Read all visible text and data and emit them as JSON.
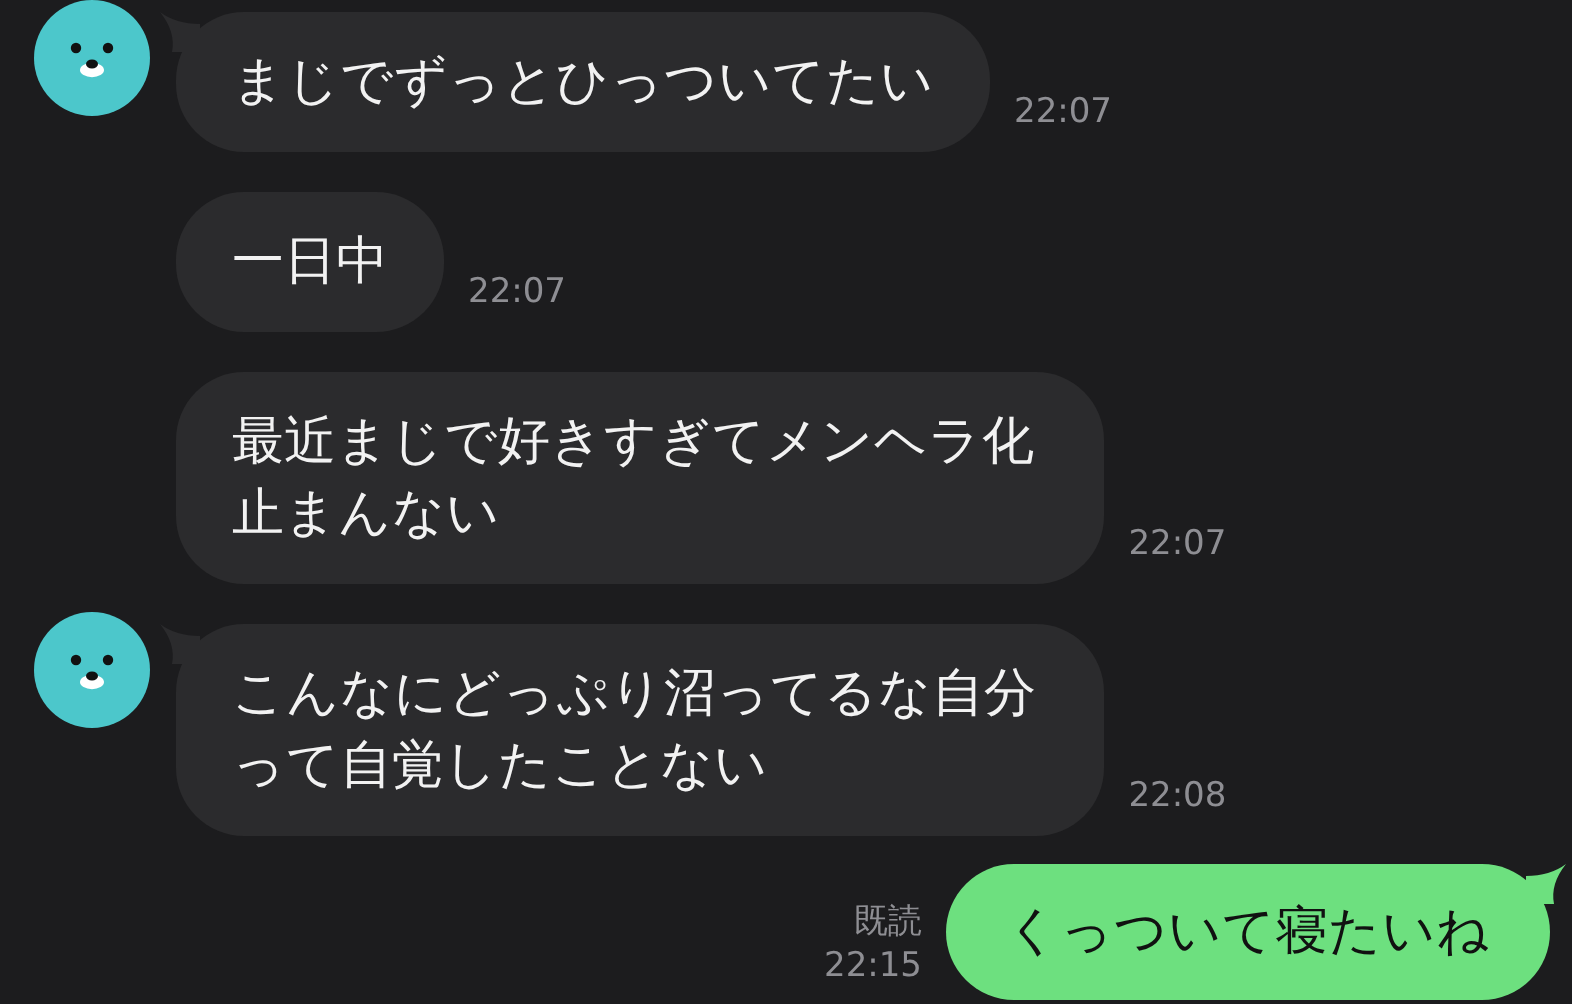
{
  "messages": [
    {
      "kind": "received",
      "avatar": true,
      "text": "まじでずっとひっついてたい",
      "time": "22:07"
    },
    {
      "kind": "received",
      "avatar": false,
      "text": "一日中",
      "time": "22:07"
    },
    {
      "kind": "received",
      "avatar": false,
      "text": "最近まじで好きすぎてメンヘラ化止まんない",
      "time": "22:07"
    },
    {
      "kind": "received",
      "avatar": true,
      "text": "こんなにどっぷり沼ってるな自分って自覚したことない",
      "time": "22:08"
    },
    {
      "kind": "sent",
      "read": "既読",
      "text": "くっついて寝たいね",
      "time": "22:15"
    }
  ]
}
